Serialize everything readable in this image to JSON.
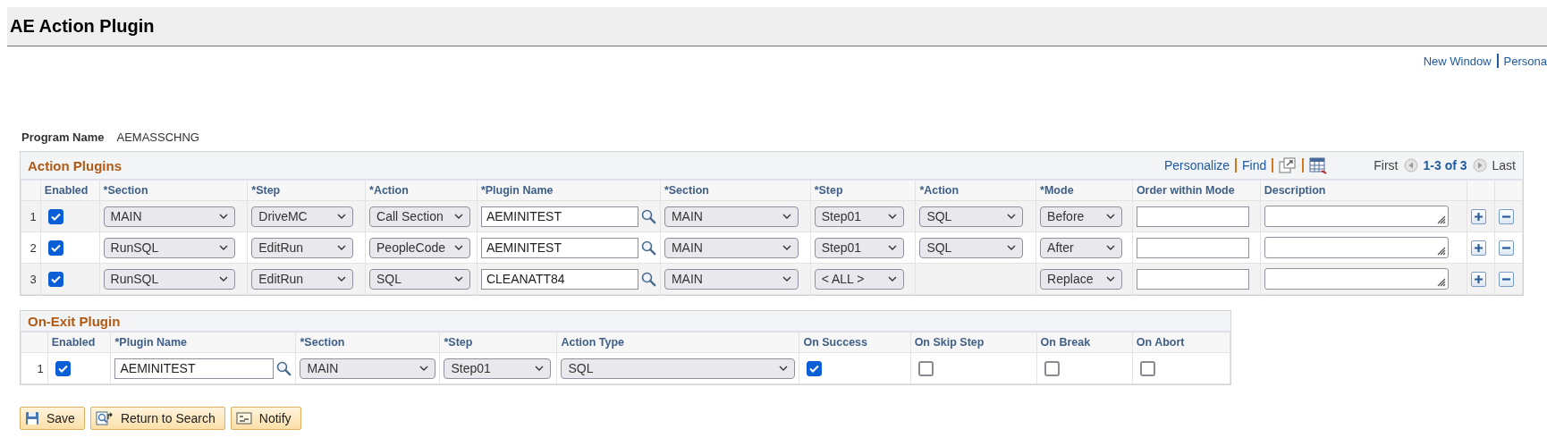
{
  "page_title": "AE Action Plugin",
  "header_links": [
    "New Window",
    "Persona"
  ],
  "program_name": {
    "label": "Program Name",
    "value": "AEMASSCHNG"
  },
  "action_plugins": {
    "title": "Action Plugins",
    "toolbar": {
      "personalize": "Personalize",
      "find": "Find",
      "first": "First",
      "range": "1-3 of 3",
      "last": "Last"
    },
    "columns": [
      "Enabled",
      "*Section",
      "*Step",
      "*Action",
      "*Plugin Name",
      "*Section",
      "*Step",
      "*Action",
      "*Mode",
      "Order within Mode",
      "Description"
    ],
    "rows": [
      {
        "number": "1",
        "enabled": true,
        "section": "MAIN",
        "step": "DriveMC",
        "action": "Call Section",
        "plugin_name": "AEMINITEST",
        "plugin_section": "MAIN",
        "plugin_step": "Step01",
        "plugin_action": "SQL",
        "mode": "Before"
      },
      {
        "number": "2",
        "enabled": true,
        "section": "RunSQL",
        "step": "EditRun",
        "action": "PeopleCode",
        "plugin_name": "AEMINITEST",
        "plugin_section": "MAIN",
        "plugin_step": "Step01",
        "plugin_action": "SQL",
        "mode": "After"
      },
      {
        "number": "3",
        "enabled": true,
        "section": "RunSQL",
        "step": "EditRun",
        "action": "SQL",
        "plugin_name": "CLEANATT84",
        "plugin_section": "MAIN",
        "plugin_step": "< ALL >",
        "mode": "Replace"
      }
    ]
  },
  "on_exit_plugin": {
    "title": "On-Exit Plugin",
    "columns": [
      "Enabled",
      "*Plugin Name",
      "*Section",
      "*Step",
      "Action Type",
      "On Success",
      "On Skip Step",
      "On Break",
      "On Abort"
    ],
    "rows": [
      {
        "number": "1",
        "enabled": true,
        "plugin_name": "AEMINITEST",
        "section": "MAIN",
        "step": "Step01",
        "action_type": "SQL",
        "on_success": true,
        "on_skip_step": false,
        "on_break": false,
        "on_abort": false
      }
    ]
  },
  "buttons": [
    {
      "label": "Save",
      "kind": "save"
    },
    {
      "label": "Return to Search",
      "kind": "return"
    },
    {
      "label": "Notify",
      "kind": "notify"
    }
  ]
}
